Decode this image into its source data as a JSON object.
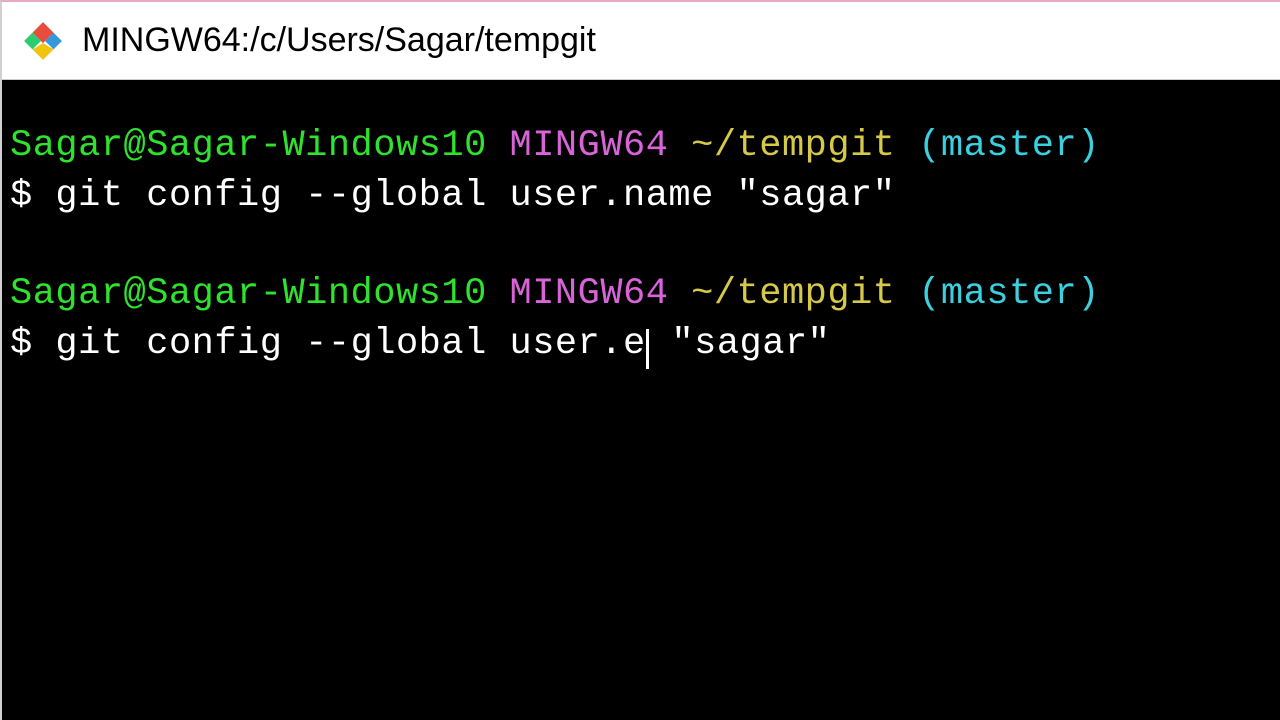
{
  "window": {
    "title": "MINGW64:/c/Users/Sagar/tempgit"
  },
  "terminal": {
    "lines": [
      {
        "user_host": "Sagar@Sagar-Windows10",
        "env": "MINGW64",
        "path": "~/tempgit",
        "branch": "(master)",
        "command": "git config --global user.name \"sagar\""
      },
      {
        "user_host": "Sagar@Sagar-Windows10",
        "env": "MINGW64",
        "path": "~/tempgit",
        "branch": "(master)",
        "command_before_cursor": "git config --global user.e",
        "command_after_cursor": " \"sagar\""
      }
    ]
  }
}
